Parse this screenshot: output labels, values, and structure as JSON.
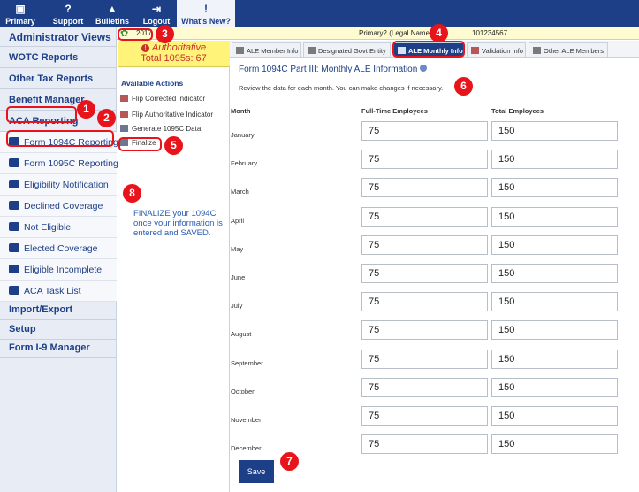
{
  "topnav": {
    "items": [
      {
        "label": "Primary",
        "icon": "person-card-icon"
      },
      {
        "label": "Support",
        "icon": "question-icon"
      },
      {
        "label": "Bulletins",
        "icon": "bell-icon"
      },
      {
        "label": "Logout",
        "icon": "logout-icon"
      },
      {
        "label": "What's New?",
        "icon": "exclamation-icon"
      }
    ]
  },
  "sidebar": {
    "title": "Administrator Views",
    "items": [
      {
        "label": "WOTC Reports"
      },
      {
        "label": "Other Tax Reports"
      },
      {
        "label": "Benefit Manager"
      },
      {
        "label": "ACA Reporting"
      }
    ],
    "sub_items": [
      {
        "label": "Form 1094C Reporting"
      },
      {
        "label": "Form 1095C Reporting"
      },
      {
        "label": "Eligibility Notification"
      },
      {
        "label": "Declined Coverage"
      },
      {
        "label": "Not Eligible"
      },
      {
        "label": "Elected Coverage"
      },
      {
        "label": "Eligible Incomplete"
      },
      {
        "label": "ACA Task List"
      }
    ],
    "bottom_items": [
      {
        "label": "Import/Export"
      },
      {
        "label": "Setup"
      },
      {
        "label": "Form I-9 Manager"
      }
    ]
  },
  "year_bar": {
    "year": "2017",
    "entity": "Primary2 (Legal Name)",
    "ein": "101234567"
  },
  "authoritative": {
    "label": "Authoritative",
    "total": "Total 1095s: 67"
  },
  "actions": {
    "heading": "Available Actions",
    "items": [
      {
        "label": "Flip Corrected Indicator"
      },
      {
        "label": "Flip Authoritative Indicator"
      },
      {
        "label": "Generate 1095C Data"
      },
      {
        "label": "Finalize"
      }
    ],
    "note": "FINALIZE your 1094C once your information is entered and SAVED."
  },
  "tabs": [
    {
      "label": "ALE Member Info"
    },
    {
      "label": "Designated Govt Entity"
    },
    {
      "label": "ALE Monthly Info"
    },
    {
      "label": "Validation Info"
    },
    {
      "label": "Other ALE Members"
    }
  ],
  "main": {
    "title": "Form 1094C Part III: Monthly ALE Information",
    "description": "Review the data for each month. You can make changes if necessary.",
    "columns": {
      "month": "Month",
      "full_time": "Full-Time Employees",
      "total": "Total Employees"
    },
    "rows": [
      {
        "month": "January",
        "full_time": "75",
        "total": "150"
      },
      {
        "month": "February",
        "full_time": "75",
        "total": "150"
      },
      {
        "month": "March",
        "full_time": "75",
        "total": "150"
      },
      {
        "month": "April",
        "full_time": "75",
        "total": "150"
      },
      {
        "month": "May",
        "full_time": "75",
        "total": "150"
      },
      {
        "month": "June",
        "full_time": "75",
        "total": "150"
      },
      {
        "month": "July",
        "full_time": "75",
        "total": "150"
      },
      {
        "month": "August",
        "full_time": "75",
        "total": "150"
      },
      {
        "month": "September",
        "full_time": "75",
        "total": "150"
      },
      {
        "month": "October",
        "full_time": "75",
        "total": "150"
      },
      {
        "month": "November",
        "full_time": "75",
        "total": "150"
      },
      {
        "month": "December",
        "full_time": "75",
        "total": "150"
      }
    ],
    "save_label": "Save"
  },
  "callouts": [
    "1",
    "2",
    "3",
    "4",
    "5",
    "6",
    "7",
    "8"
  ],
  "colors": {
    "brand": "#1d3f87",
    "highlight": "#e8141b",
    "auth_bg": "#fff37a"
  }
}
